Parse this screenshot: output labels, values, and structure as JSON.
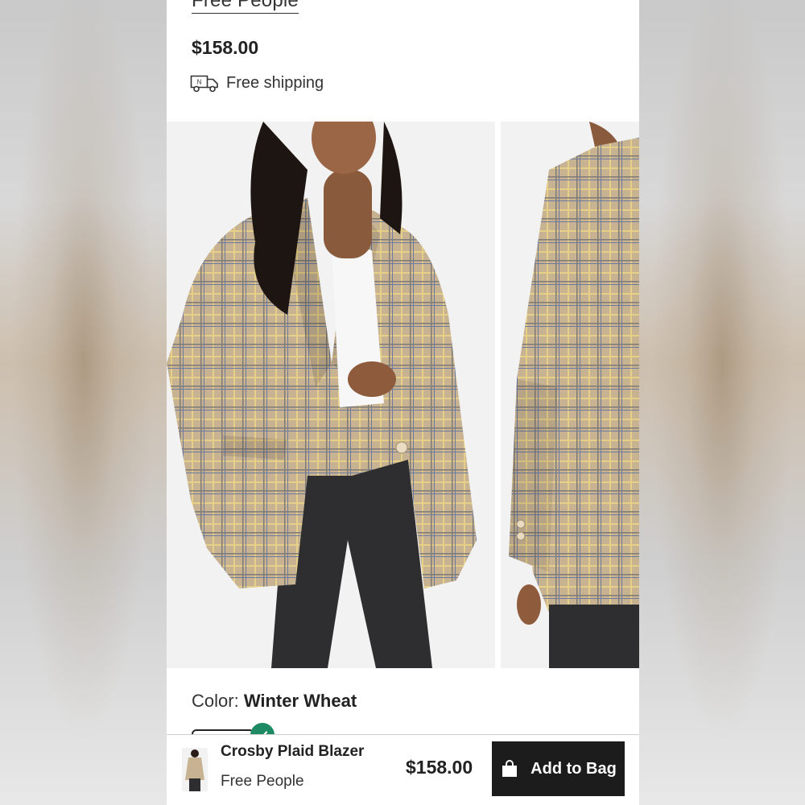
{
  "product": {
    "brand": "Free People",
    "price": "$158.00",
    "shipping_text": "Free shipping",
    "color_label": "Color:",
    "color_value": "Winter Wheat"
  },
  "gallery": {
    "images": [
      {
        "name": "front-view"
      },
      {
        "name": "side-view"
      }
    ]
  },
  "sticky_bar": {
    "title": "Crosby Plaid Blazer",
    "brand": "Free People",
    "price": "$158.00",
    "add_to_bag_label": "Add to Bag"
  },
  "icons": {
    "shipping": "delivery-truck-icon",
    "bag": "shopping-bag-icon",
    "selected": "check-icon"
  },
  "colors": {
    "accent_green": "#1e8a63",
    "button_dark": "#1c1c1c"
  }
}
